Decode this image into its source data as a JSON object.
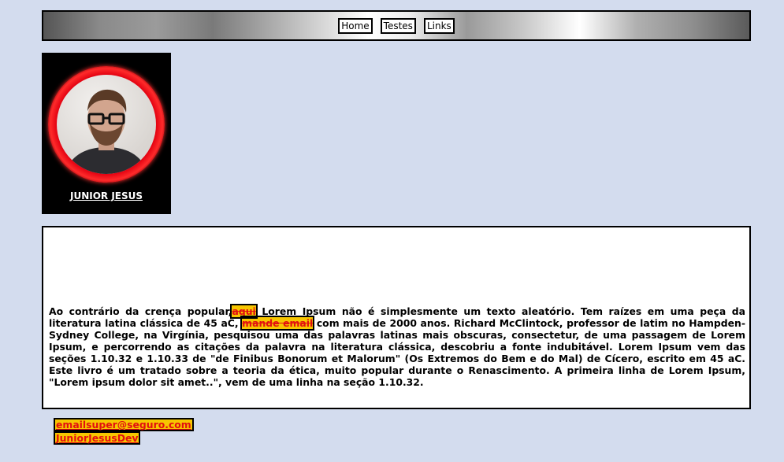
{
  "nav": {
    "items": [
      {
        "label": "Home"
      },
      {
        "label": "Testes"
      },
      {
        "label": "Links"
      }
    ]
  },
  "profile": {
    "name": "JUNIOR JESUS"
  },
  "content": {
    "part1": "Ao contrário da crença popular,",
    "link1": "aqui",
    "part2": " Lorem Ipsum não é simplesmente um texto aleatório. Tem raízes em uma peça da literatura latina clássica de 45 aC, ",
    "link2": "mande email",
    "part3": " com mais de 2000 anos. Richard McClintock, professor de latim no Hampden-Sydney College, na Virgínia, pesquisou uma das palavras latinas mais obscuras, consectetur, de uma passagem de Lorem Ipsum, e percorrendo as citações da palavra na literatura clássica, descobriu a fonte indubitável. Lorem Ipsum vem das seções 1.10.32 e 1.10.33 de \"de Finibus Bonorum et Malorum\" (Os Extremos do Bem e do Mal) de Cícero, escrito em 45 aC. Este livro é um tratado sobre a teoria da ética, muito popular durante o Renascimento. A primeira linha de Lorem Ipsum, \"Lorem ipsum dolor sit amet..\", vem de uma linha na seção 1.10.32."
  },
  "footer": {
    "email": "emailsuper@seguro.com",
    "handle": "JuniorJesusDev"
  },
  "colors": {
    "page_background": "#d3dcee",
    "highlight": "#f7c600",
    "link_red": "#e21010",
    "avatar_ring": "#e20010"
  }
}
